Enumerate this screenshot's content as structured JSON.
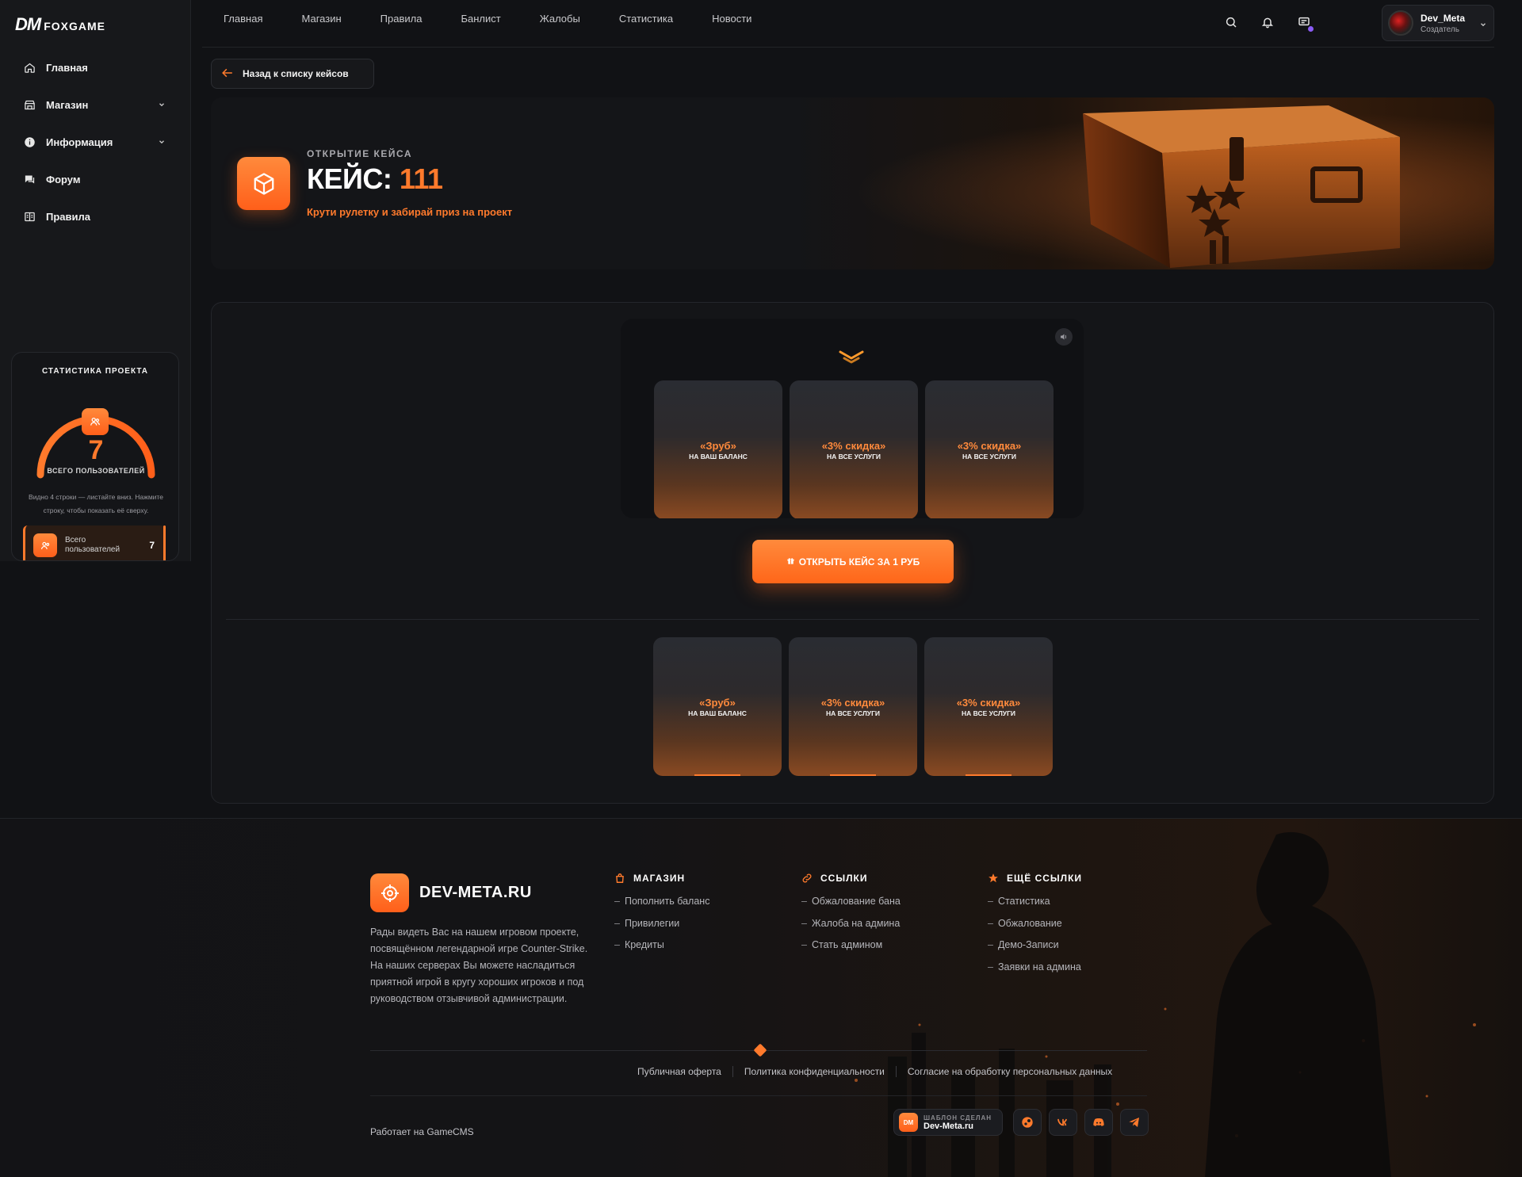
{
  "brand": {
    "logo_mark": "DM",
    "name": "FOXGAME"
  },
  "sidebar": {
    "items": [
      {
        "label": "Главная",
        "icon": "home-icon"
      },
      {
        "label": "Магазин",
        "icon": "shop-icon",
        "has_submenu": true
      },
      {
        "label": "Информация",
        "icon": "info-icon",
        "has_submenu": true
      },
      {
        "label": "Форум",
        "icon": "forum-icon"
      },
      {
        "label": "Правила",
        "icon": "rules-icon"
      }
    ],
    "stats": {
      "title": "СТАТИСТИКА ПРОЕКТА",
      "value": "7",
      "value_label": "ВСЕГО ПОЛЬЗОВАТЕЛЕЙ",
      "hint": "Видно 4 строки — листайте вниз. Нажмите строку, чтобы показать её сверху.",
      "rows": [
        {
          "label": "Всего пользователей",
          "value": "7"
        }
      ]
    }
  },
  "topnav": {
    "items": [
      "Главная",
      "Магазин",
      "Правила",
      "Банлист",
      "Жалобы",
      "Статистика",
      "Новости"
    ]
  },
  "user": {
    "name": "Dev_Meta",
    "role": "Создатель"
  },
  "back_button": {
    "label": "Назад к списку кейсов"
  },
  "hero": {
    "subtitle": "ОТКРЫТИЕ КЕЙСА",
    "title_prefix": "КЕЙС:",
    "title_number": "111",
    "description": "Крути рулетку и забирай приз на проект"
  },
  "roulette": {
    "items": [
      {
        "title": "«Зруб»",
        "subtitle": "НА ВАШ БАЛАНС"
      },
      {
        "title": "«3% скидка»",
        "subtitle": "НА ВСЕ УСЛУГИ"
      },
      {
        "title": "«3% скидка»",
        "subtitle": "НА ВСЕ УСЛУГИ"
      }
    ]
  },
  "open_button": {
    "label": "ОТКРЫТЬ КЕЙС ЗА 1 РУБ"
  },
  "prizes": {
    "items": [
      {
        "title": "«Зруб»",
        "subtitle": "НА ВАШ БАЛАНС"
      },
      {
        "title": "«3% скидка»",
        "subtitle": "НА ВСЕ УСЛУГИ"
      },
      {
        "title": "«3% скидка»",
        "subtitle": "НА ВСЕ УСЛУГИ"
      }
    ]
  },
  "footer": {
    "site_name": "DEV-META.RU",
    "about": "Рады видеть Вас на нашем игровом проекте, посвящённом легендарной игре Counter-Strike. На наших серверах Вы можете насладиться приятной игрой в кругу хороших игроков и под руководством отзывчивой администрации.",
    "columns": [
      {
        "title": "МАГАЗИН",
        "icon": "bag-icon",
        "items": [
          "Пополнить баланс",
          "Привилегии",
          "Кредиты"
        ]
      },
      {
        "title": "ССЫЛКИ",
        "icon": "link-icon",
        "items": [
          "Обжалование бана",
          "Жалоба на админа",
          "Стать админом"
        ]
      },
      {
        "title": "ЕЩЁ ССЫЛКИ",
        "icon": "star-icon",
        "items": [
          "Статистика",
          "Обжалование",
          "Демо-Записи",
          "Заявки на админа"
        ]
      }
    ],
    "legal_links": [
      "Публичная оферта",
      "Политика конфиденциальности",
      "Согласие на обработку персональных данных"
    ],
    "powered_by": "Работает на GameCMS",
    "made_by": {
      "line1": "ШАБЛОН СДЕЛАН",
      "line2": "Dev-Meta.ru",
      "mark": "DM"
    },
    "socials": [
      "steam-icon",
      "vk-icon",
      "discord-icon",
      "telegram-icon"
    ]
  },
  "colors": {
    "accent": "#ff7a2c",
    "background": "#111215",
    "panel": "#141518",
    "notification_dot": "#8b5cf6"
  }
}
